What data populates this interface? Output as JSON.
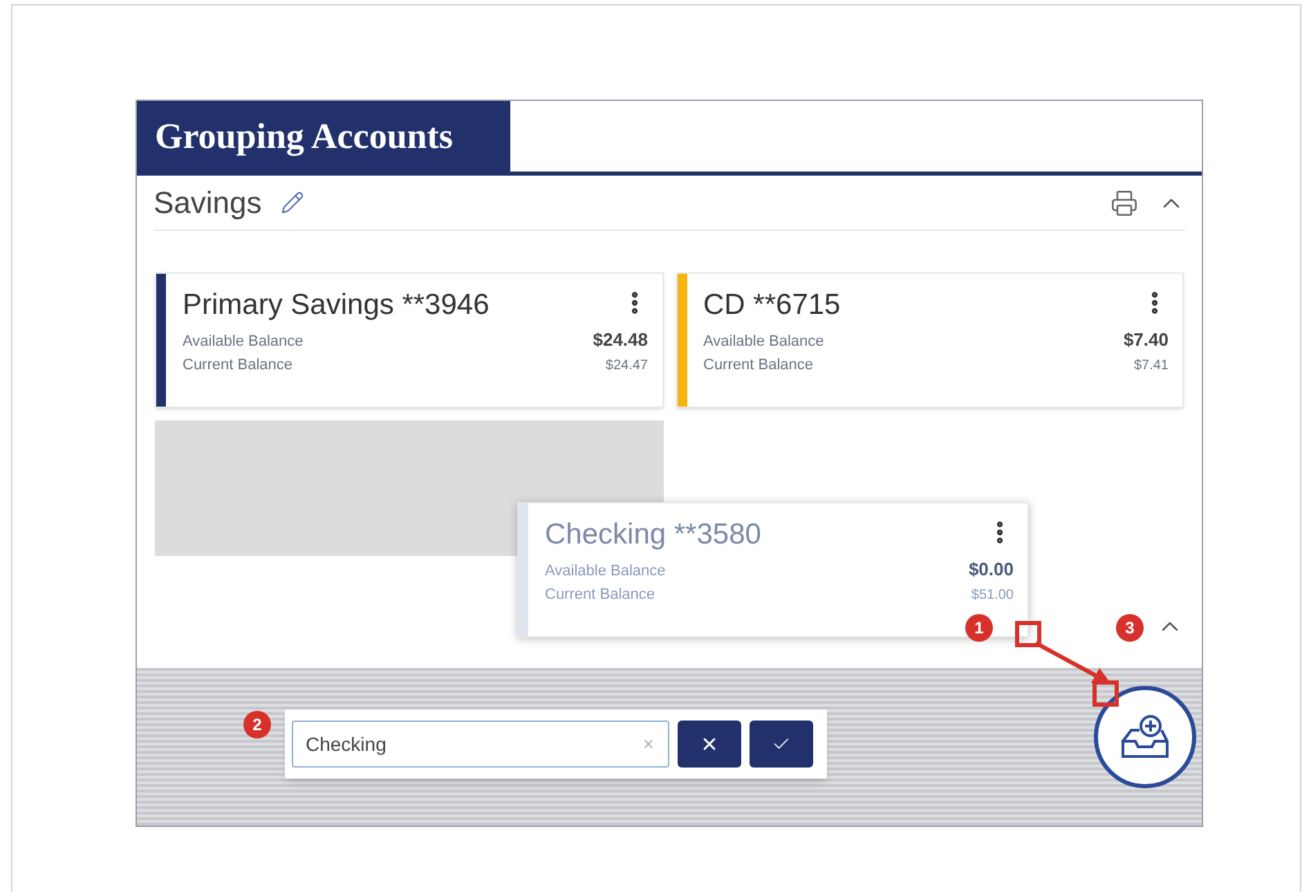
{
  "title": "Grouping Accounts",
  "group": {
    "name": "Savings",
    "expanded": true
  },
  "accounts": [
    {
      "name": "Primary Savings **3946",
      "color": "#22306b",
      "rows": [
        {
          "label": "Available Balance",
          "value": "$24.48"
        },
        {
          "label": "Current Balance",
          "value": "$24.47"
        }
      ]
    },
    {
      "name": "CD **6715",
      "color": "#f5b40f",
      "rows": [
        {
          "label": "Available Balance",
          "value": "$7.40"
        },
        {
          "label": "Current Balance",
          "value": "$7.41"
        }
      ]
    }
  ],
  "dragged_account": {
    "name": "Checking **3580",
    "color": "#dde4ee",
    "rows": [
      {
        "label": "Available Balance",
        "value": "$0.00"
      },
      {
        "label": "Current Balance",
        "value": "$51.00"
      }
    ]
  },
  "drop_group": {
    "expanded": true
  },
  "new_group": {
    "value": "Checking"
  },
  "callouts": [
    "1",
    "2",
    "3"
  ]
}
